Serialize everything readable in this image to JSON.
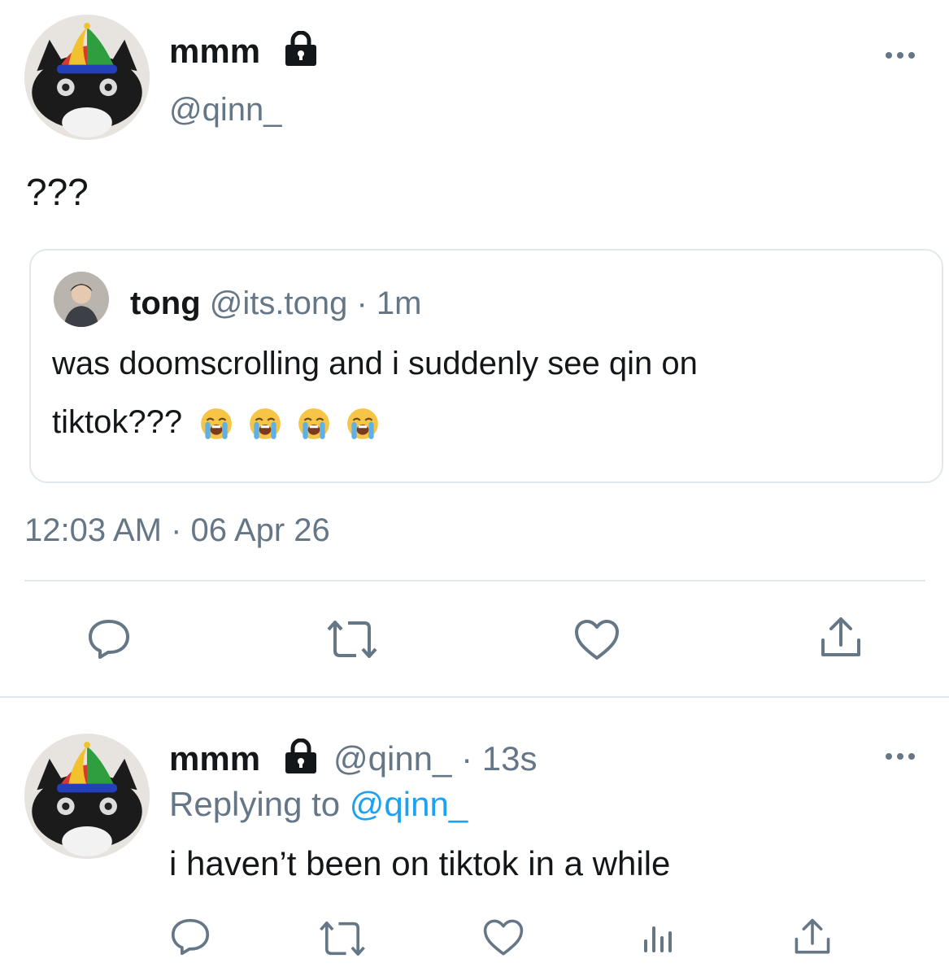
{
  "main_tweet": {
    "display_name": "mmm",
    "handle": "@qinn_",
    "text": "???",
    "timestamp": "12:03 AM · 06 Apr 26",
    "locked_icon": "lock-icon",
    "more_icon": "more-icon"
  },
  "quoted_tweet": {
    "display_name": "tong",
    "handle": "@its.tong",
    "separator": "·",
    "age": "1m",
    "text_line1": "was doomscrolling and i suddenly see qin on",
    "text_line2": "tiktok???",
    "emoji": [
      "loudly-crying-face",
      "loudly-crying-face",
      "loudly-crying-face",
      "loudly-crying-face"
    ]
  },
  "actions": {
    "reply_icon": "reply-icon",
    "retweet_icon": "retweet-icon",
    "like_icon": "like-icon",
    "share_icon": "share-icon",
    "analytics_icon": "analytics-icon"
  },
  "reply_tweet": {
    "display_name": "mmm",
    "handle": "@qinn_",
    "separator": "·",
    "age": "13s",
    "replying_prefix": "Replying to",
    "replying_handle": "@qinn_",
    "text": "i haven’t been on tiktok in a while"
  },
  "colors": {
    "accent": "#1da1f2",
    "muted": "#657786",
    "border": "#e1e8ed",
    "text": "#14171a"
  }
}
